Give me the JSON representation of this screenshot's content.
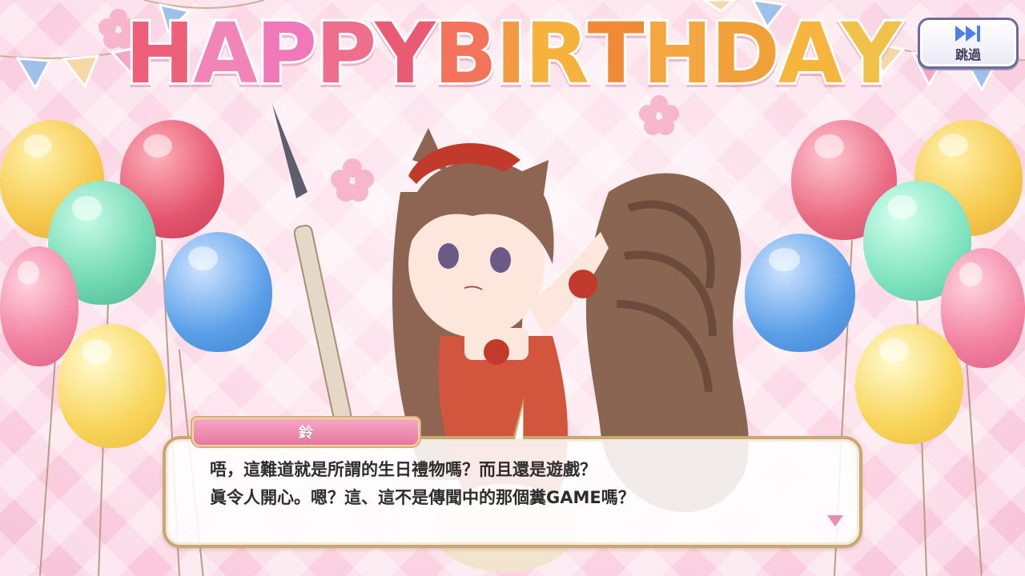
{
  "banner": {
    "title_letters": [
      "H",
      "A",
      "P",
      "P",
      "Y",
      " ",
      "B",
      "I",
      "R",
      "T",
      "H",
      "D",
      "A",
      "Y"
    ],
    "letter_colors": [
      "#ee5f7a",
      "#f285b8",
      "#f078b8",
      "#ee6e8c",
      "#ea5a73",
      "#ffffff",
      "#f3745a",
      "#f39a45",
      "#f7b23d",
      "#f08a35",
      "#f4a640",
      "#f1a03a",
      "#f6b53c",
      "#f0c24a"
    ]
  },
  "skip_button": {
    "icon": "fast-forward-icon",
    "label": "跳過",
    "color": "#4f7fe6"
  },
  "dialogue": {
    "speaker": "鈴",
    "line1": "唔，這難道就是所謂的生日禮物嗎？而且還是遊戲？",
    "line2": "眞令人開心。嗯？這、這不是傳聞中的那個糞GAME嗎？",
    "next_icon": "next-triangle-icon",
    "accent": "#ee89b2"
  },
  "scene": {
    "character": "squirrel-girl-character",
    "balloon_colors": [
      "#f6c84b",
      "#e4556d",
      "#6fd7b2",
      "#5b9fe8",
      "#f282a2",
      "#f8d55a",
      "#f0a8c0"
    ]
  }
}
